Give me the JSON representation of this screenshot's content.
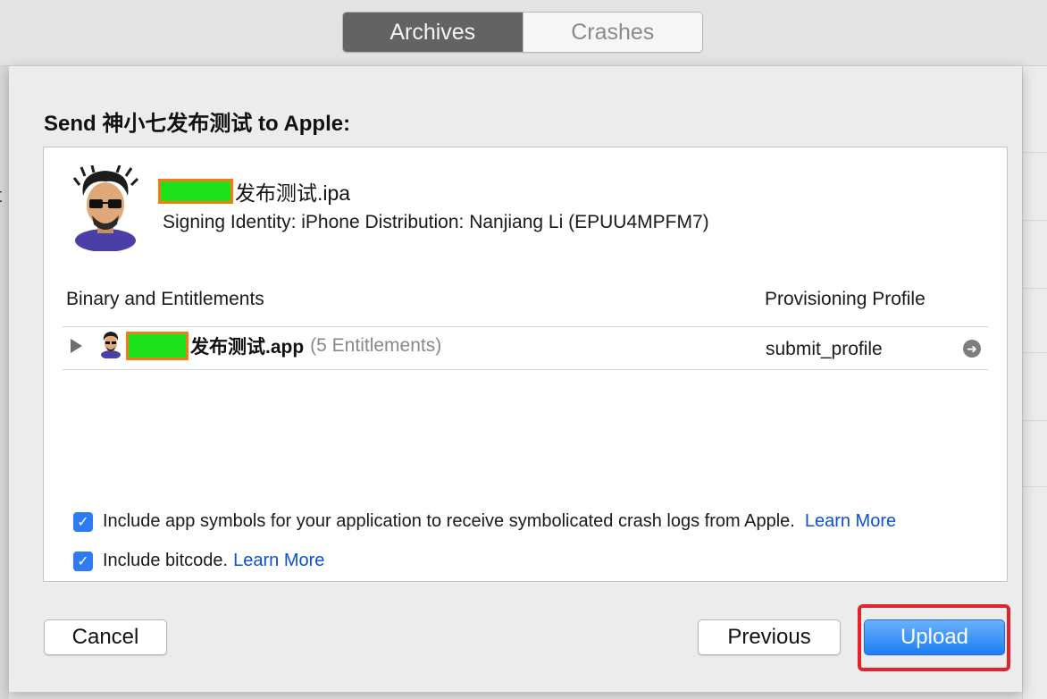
{
  "toolbar": {
    "tabs": [
      {
        "label": "Archives",
        "selected": true
      },
      {
        "label": "Crashes",
        "selected": false
      }
    ]
  },
  "sheet": {
    "title": "Send 神小七发布测试 to Apple:",
    "ipa": {
      "filename_suffix": "发布测试.ipa",
      "signing_identity": "Signing Identity: iPhone Distribution: Nanjiang Li (EPUU4MPFM7)"
    },
    "table": {
      "columns": [
        "Binary and Entitlements",
        "Provisioning Profile"
      ],
      "rows": [
        {
          "app_suffix": "发布测试.app",
          "entitlements": "(5 Entitlements)",
          "profile": "submit_profile"
        }
      ]
    },
    "options": {
      "symbols_label": "Include app symbols for your application to receive symbolicated crash logs from Apple.",
      "bitcode_label": "Include bitcode.",
      "learn_more": "Learn More",
      "symbols_checked": true,
      "bitcode_checked": true
    },
    "buttons": {
      "cancel": "Cancel",
      "previous": "Previous",
      "upload": "Upload"
    }
  },
  "colors": {
    "accent": "#1a7ff3",
    "link": "#0a4fd8",
    "highlight": "#e2232a",
    "redaction_fill": "#1ce21c",
    "redaction_border": "#f47c14"
  }
}
